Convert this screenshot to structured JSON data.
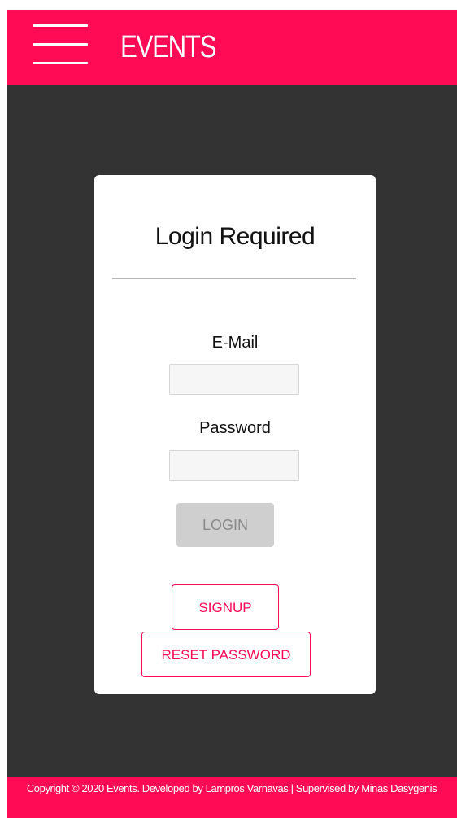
{
  "header": {
    "brand": "EVENTS",
    "menu_icon": "hamburger-menu-icon"
  },
  "login": {
    "title": "Login Required",
    "email_label": "E-Mail",
    "email_value": "",
    "password_label": "Password",
    "password_value": "",
    "login_button": "LOGIN",
    "signup_button": "SIGNUP",
    "reset_button": "RESET PASSWORD"
  },
  "footer": {
    "text": "Copyright © 2020 Events. Developed by Lampros Varnavas | Supervised by Minas Dasygenis"
  },
  "colors": {
    "accent": "#ff0a54",
    "background": "#333333",
    "card": "#ffffff",
    "disabled_button": "#cfcfcf"
  }
}
